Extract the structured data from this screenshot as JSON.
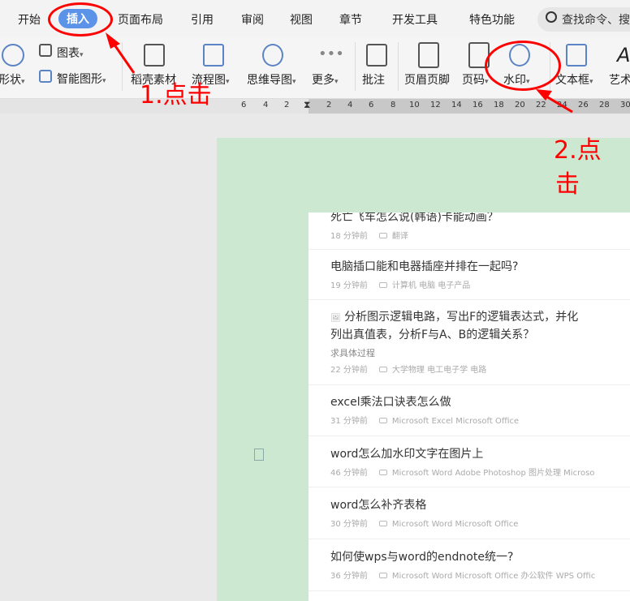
{
  "tabs": [
    "开始",
    "插入",
    "页面布局",
    "引用",
    "审阅",
    "视图",
    "章节",
    "开发工具",
    "特色功能"
  ],
  "search_placeholder": "查找命令、搜",
  "ribbon": {
    "shape": "形状",
    "chart": "图表",
    "smart": "智能图形",
    "material": "稻壳素材",
    "flow": "流程图",
    "mind": "思维导图",
    "more": "更多",
    "comment": "批注",
    "header_footer": "页眉页脚",
    "page_num": "页码",
    "watermark": "水印",
    "textbox": "文本框",
    "art": "艺术"
  },
  "ruler": [
    "6",
    "4",
    "2",
    "2",
    "4",
    "6",
    "8",
    "10",
    "12",
    "14",
    "16",
    "18",
    "20",
    "22",
    "24",
    "26",
    "28",
    "30"
  ],
  "items": [
    {
      "title": "死亡飞车怎么说(韩语)卡能动画？",
      "time": "18 分钟前",
      "tags": "翻译"
    },
    {
      "title": "电脑插口能和电器插座并排在一起吗?",
      "time": "19 分钟前",
      "tags": "计算机 电脑 电子产品"
    },
    {
      "title": "分析图示逻辑电路，写出F的逻辑表达式，并化",
      "title2": "列出真值表，分析F与A、B的逻辑关系？",
      "sub": "求具体过程",
      "time": "22 分钟前",
      "tags": "大学物理 电工电子学 电路"
    },
    {
      "title": "excel乘法口诀表怎么做",
      "time": "31 分钟前",
      "tags": "Microsoft Excel Microsoft Office"
    },
    {
      "title": "word怎么加水印文字在图片上",
      "time": "46 分钟前",
      "tags": "Microsoft Word Adobe Photoshop 图片处理 Microso"
    },
    {
      "title": "word怎么补齐表格",
      "time": "30 分钟前",
      "tags": "Microsoft Word Microsoft Office"
    },
    {
      "title": "如何使wps与word的endnote统一?",
      "time": "36 分钟前",
      "tags": "Microsoft Word Microsoft Office 办公软件 WPS Offic"
    }
  ],
  "annotations": {
    "step1": "1.点击",
    "step2a": "2.点",
    "step2b": "击"
  }
}
